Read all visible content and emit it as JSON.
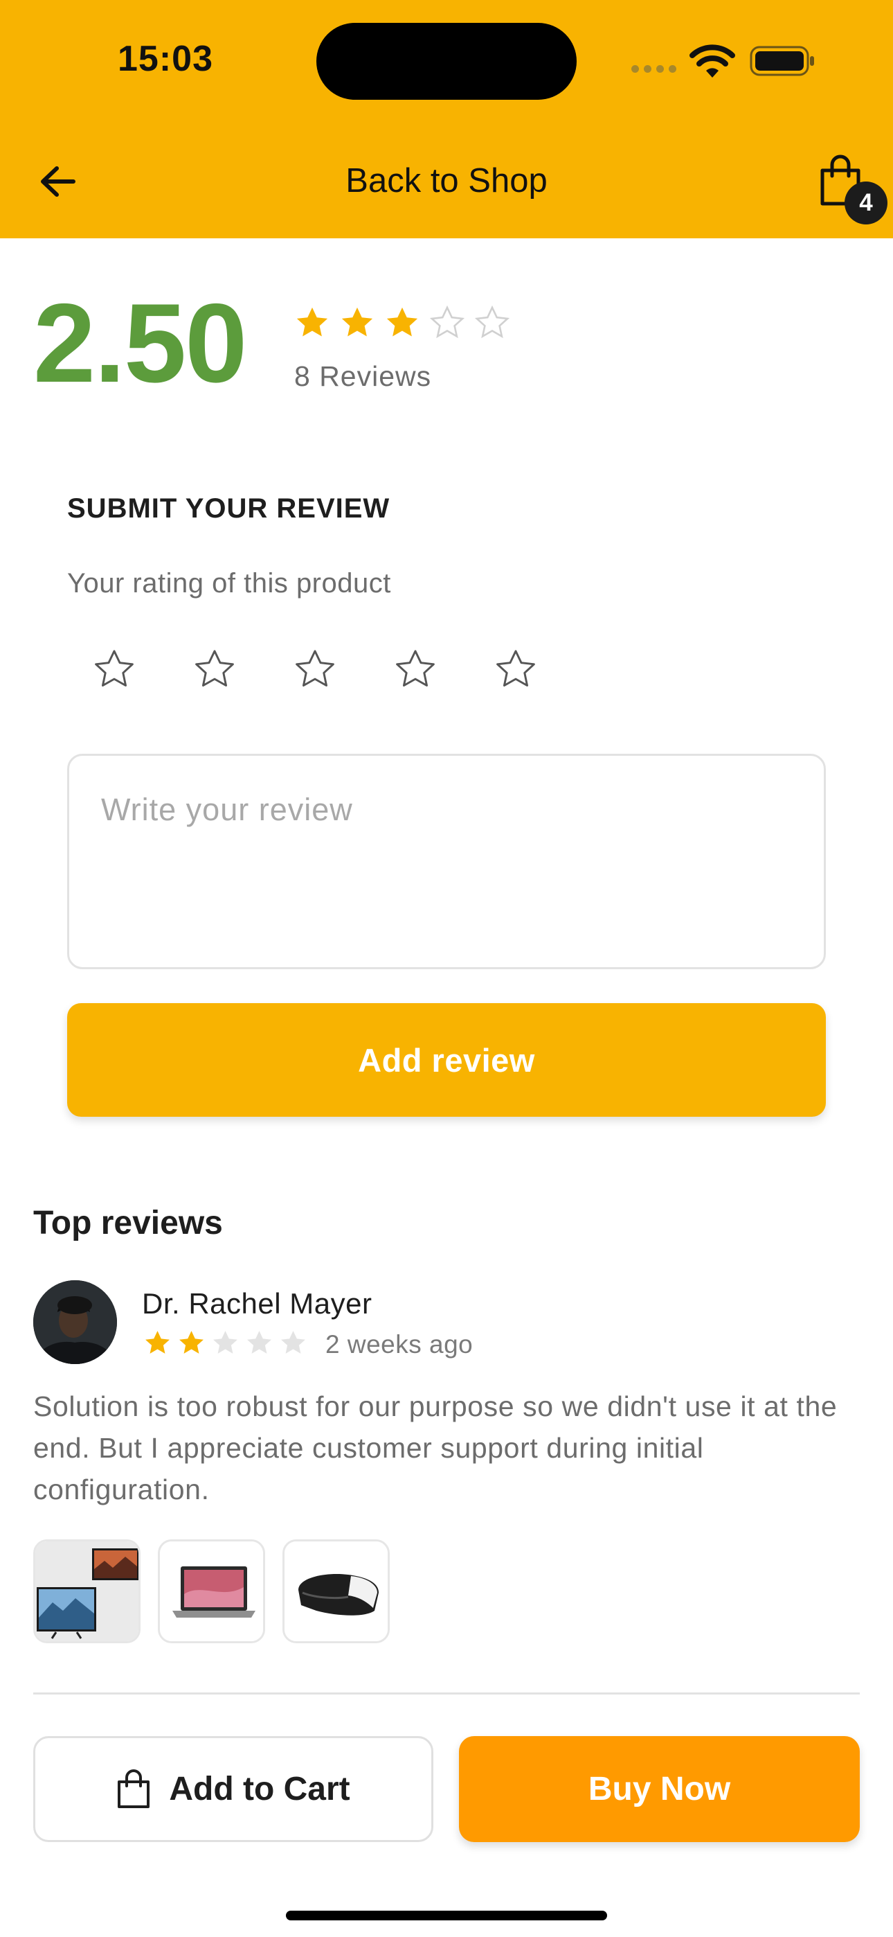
{
  "status_bar": {
    "time": "15:03"
  },
  "header": {
    "title": "Back to Shop",
    "cart_count": "4"
  },
  "rating_summary": {
    "average": "2.50",
    "stars_filled": 3,
    "stars_total": 5,
    "reviews_count": "8 Reviews"
  },
  "submit_review": {
    "title": "SUBMIT YOUR REVIEW",
    "rating_label": "Your rating of this product",
    "input_placeholder": "Write your review",
    "button_label": "Add review"
  },
  "top_reviews": {
    "title": "Top reviews",
    "items": [
      {
        "name": "Dr. Rachel Mayer",
        "stars_filled": 2,
        "date": "2 weeks ago",
        "text": "Solution is too robust for our purpose so we didn't use it at the end. But I appreciate customer support during initial configuration.",
        "images": [
          "tv-image",
          "laptop-image",
          "vr-headset-image"
        ]
      }
    ]
  },
  "actions": {
    "add_to_cart": "Add to Cart",
    "buy_now": "Buy Now"
  },
  "colors": {
    "brand_yellow": "#F8B301",
    "rating_green": "#5C9C3C",
    "buy_orange": "#FF9A00",
    "star_gold": "#F8B301"
  }
}
